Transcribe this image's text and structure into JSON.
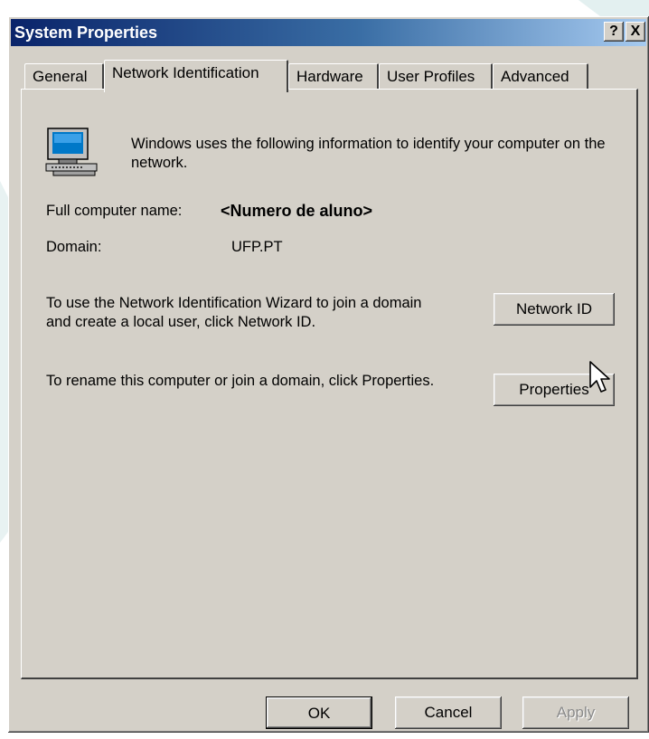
{
  "window": {
    "title": "System Properties",
    "help_button": "?",
    "close_button": "X"
  },
  "tabs": [
    {
      "label": "General",
      "active": false
    },
    {
      "label": "Network Identification",
      "active": true
    },
    {
      "label": "Hardware",
      "active": false
    },
    {
      "label": "User Profiles",
      "active": false
    },
    {
      "label": "Advanced",
      "active": false
    }
  ],
  "panel": {
    "intro": "Windows uses the following information to identify your computer on the network.",
    "full_name_label": "Full computer name:",
    "full_name_value": "<Numero de aluno>",
    "domain_label": "Domain:",
    "domain_value": "UFP.PT",
    "wizard_text": "To use the Network Identification Wizard to join a domain and create a local user, click Network ID.",
    "network_id_button": "Network ID",
    "rename_text": "To rename this computer or join a domain, click Properties.",
    "properties_button": "Properties"
  },
  "footer": {
    "ok": "OK",
    "cancel": "Cancel",
    "apply": "Apply"
  },
  "colors": {
    "titlebar_start": "#0a246a",
    "titlebar_end": "#a6caf0",
    "face": "#d4d0c8"
  },
  "icons": [
    "computer-icon",
    "help-icon",
    "close-icon",
    "mouse-pointer-icon"
  ]
}
